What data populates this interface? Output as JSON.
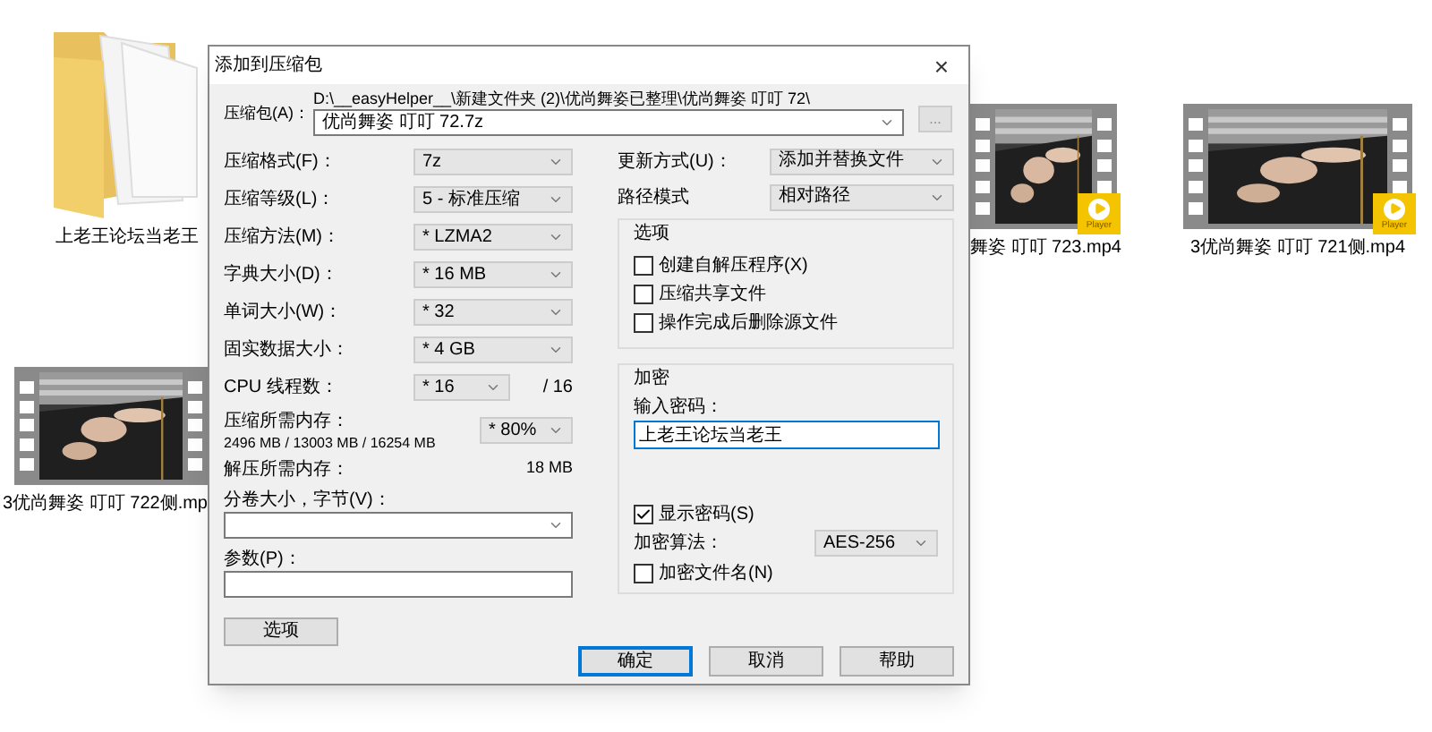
{
  "desktop": {
    "icons": [
      {
        "kind": "folder",
        "label": "上老王论坛当老王"
      },
      {
        "kind": "video",
        "label": "3优尚舞姿 叮叮 722侧.mp"
      },
      {
        "kind": "video",
        "label": "舞姿 叮叮 723.mp4",
        "badge": "Player"
      },
      {
        "kind": "video",
        "label": "3优尚舞姿 叮叮 721侧.mp4",
        "badge": "Player"
      }
    ]
  },
  "dialog": {
    "title": "添加到压缩包",
    "close": "×",
    "archive": {
      "label": "压缩包(A)：",
      "path": "D:\\__easyHelper__\\新建文件夹 (2)\\优尚舞姿已整理\\优尚舞姿 叮叮 72\\",
      "value": "优尚舞姿 叮叮 72.7z",
      "browse": "..."
    },
    "settings": [
      {
        "label": "压缩格式(F)：",
        "value": "7z"
      },
      {
        "label": "压缩等级(L)：",
        "value": "5 - 标准压缩"
      },
      {
        "label": "压缩方法(M)：",
        "value": "* LZMA2"
      },
      {
        "label": "字典大小(D)：",
        "value": "* 16 MB"
      },
      {
        "label": "单词大小(W)：",
        "value": "* 32"
      },
      {
        "label": "固实数据大小：",
        "value": "* 4 GB"
      }
    ],
    "cpu": {
      "label": "CPU 线程数：",
      "value": "* 16",
      "total": "/ 16"
    },
    "memory": {
      "label": "压缩所需内存：",
      "detail": "2496 MB / 13003 MB / 16254 MB",
      "value": "* 80%"
    },
    "decompress": {
      "label": "解压所需内存：",
      "value": "18 MB"
    },
    "volume": {
      "label": "分卷大小，字节(V)："
    },
    "params": {
      "label": "参数(P)："
    },
    "options_button": "选项",
    "update": {
      "label": "更新方式(U)：",
      "value": "添加并替换文件"
    },
    "path_mode": {
      "label": "路径模式",
      "value": "相对路径"
    },
    "options": {
      "title": "选项",
      "checkboxes": [
        {
          "label": "创建自解压程序(X)",
          "checked": false
        },
        {
          "label": "压缩共享文件",
          "checked": false
        },
        {
          "label": "操作完成后删除源文件",
          "checked": false
        }
      ]
    },
    "encryption": {
      "title": "加密",
      "password_label": "输入密码：",
      "password": "上老王论坛当老王",
      "show_password": {
        "label": "显示密码(S)",
        "checked": true
      },
      "method": {
        "label": "加密算法：",
        "value": "AES-256"
      },
      "encrypt_names": {
        "label": "加密文件名(N)",
        "checked": false
      }
    },
    "buttons": [
      {
        "label": "确定",
        "focused": true
      },
      {
        "label": "取消",
        "focused": false
      },
      {
        "label": "帮助",
        "focused": false
      }
    ]
  }
}
